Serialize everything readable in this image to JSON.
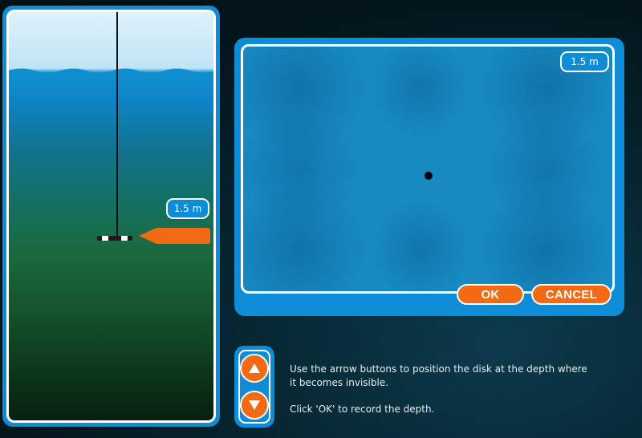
{
  "simulation": {
    "depth_label": "1.5 m",
    "view_depth_label": "1.5 m"
  },
  "buttons": {
    "ok_label": "OK",
    "cancel_label": "CANCEL"
  },
  "controls": {
    "up_icon": "triangle-up-icon",
    "down_icon": "triangle-down-icon"
  },
  "instructions": {
    "line1": "Use the arrow buttons to position the disk at the depth where it becomes invisible.",
    "line2": "Click 'OK' to record the depth."
  },
  "colors": {
    "panel_blue": "#0e8cd6",
    "button_orange": "#f26a14",
    "view_water": "#178ac2"
  }
}
